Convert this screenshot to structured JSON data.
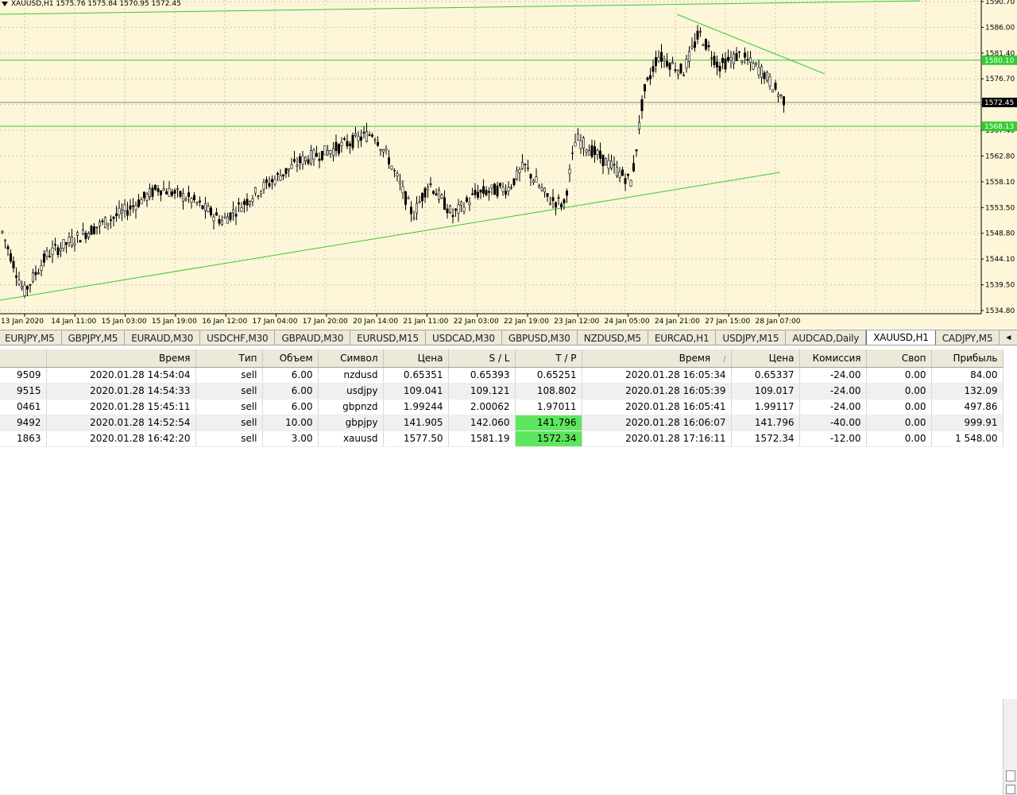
{
  "chart": {
    "symbol_line": "XAUUSD,H1  1575.76 1575.84 1570.95 1572.45",
    "price_labels": [
      "1590.70",
      "1586.00",
      "1581.40",
      "1576.70",
      "1572.45",
      "1567.40",
      "1562.80",
      "1558.10",
      "1553.50",
      "1548.80",
      "1544.10",
      "1539.50",
      "1534.80"
    ],
    "highlight_labels": [
      {
        "text": "1580.10",
        "color": "#33cc33"
      },
      {
        "text": "1572.45",
        "color": "#000000"
      },
      {
        "text": "1568.13",
        "color": "#33cc33"
      }
    ],
    "time_labels": [
      "13 Jan 2020",
      "14 Jan 11:00",
      "15 Jan 03:00",
      "15 Jan 19:00",
      "16 Jan 12:00",
      "17 Jan 04:00",
      "17 Jan 20:00",
      "20 Jan 14:00",
      "21 Jan 11:00",
      "22 Jan 03:00",
      "22 Jan 19:00",
      "23 Jan 12:00",
      "24 Jan 05:00",
      "24 Jan 21:00",
      "27 Jan 15:00",
      "28 Jan 07:00"
    ],
    "colors": {
      "background": "#fdf6d8",
      "line": "#33cc33",
      "candle": "#000000"
    }
  },
  "tabs": [
    {
      "label": "EURJPY,M5"
    },
    {
      "label": "GBPJPY,M5"
    },
    {
      "label": "EURAUD,M30"
    },
    {
      "label": "USDCHF,M30"
    },
    {
      "label": "GBPAUD,M30"
    },
    {
      "label": "EURUSD,M15"
    },
    {
      "label": "USDCAD,M30"
    },
    {
      "label": "GBPUSD,M30"
    },
    {
      "label": "NZDUSD,M5"
    },
    {
      "label": "EURCAD,H1"
    },
    {
      "label": "USDJPY,M15"
    },
    {
      "label": "AUDCAD,Daily"
    },
    {
      "label": "XAUUSD,H1",
      "active": true
    },
    {
      "label": "CADJPY,M5"
    }
  ],
  "tab_scroll": {
    "left": "◄",
    "right": "►"
  },
  "table": {
    "headers": [
      "",
      "Время",
      "Тип",
      "Объем",
      "Символ",
      "Цена",
      "S / L",
      "T / P",
      "Время",
      "Цена",
      "Комиссия",
      "Своп",
      "Прибыль"
    ],
    "sort_marker": "/",
    "rows": [
      [
        "9509",
        "2020.01.28 14:54:04",
        "sell",
        "6.00",
        "nzdusd",
        "0.65351",
        "0.65393",
        "0.65251",
        "2020.01.28 16:05:34",
        "0.65337",
        "-24.00",
        "0.00",
        "84.00"
      ],
      [
        "9515",
        "2020.01.28 14:54:33",
        "sell",
        "6.00",
        "usdjpy",
        "109.041",
        "109.121",
        "108.802",
        "2020.01.28 16:05:39",
        "109.017",
        "-24.00",
        "0.00",
        "132.09"
      ],
      [
        "0461",
        "2020.01.28 15:45:11",
        "sell",
        "6.00",
        "gbpnzd",
        "1.99244",
        "2.00062",
        "1.97011",
        "2020.01.28 16:05:41",
        "1.99117",
        "-24.00",
        "0.00",
        "497.86"
      ],
      [
        "9492",
        "2020.01.28 14:52:54",
        "sell",
        "10.00",
        "gbpjpy",
        "141.905",
        "142.060",
        "141.796",
        "2020.01.28 16:06:07",
        "141.796",
        "-40.00",
        "0.00",
        "999.91"
      ],
      [
        "1863",
        "2020.01.28 16:42:20",
        "sell",
        "3.00",
        "xauusd",
        "1577.50",
        "1581.19",
        "1572.34",
        "2020.01.28 17:16:11",
        "1572.34",
        "-12.00",
        "0.00",
        "1 548.00"
      ]
    ],
    "tp_hit_rows": [
      3,
      4
    ]
  }
}
